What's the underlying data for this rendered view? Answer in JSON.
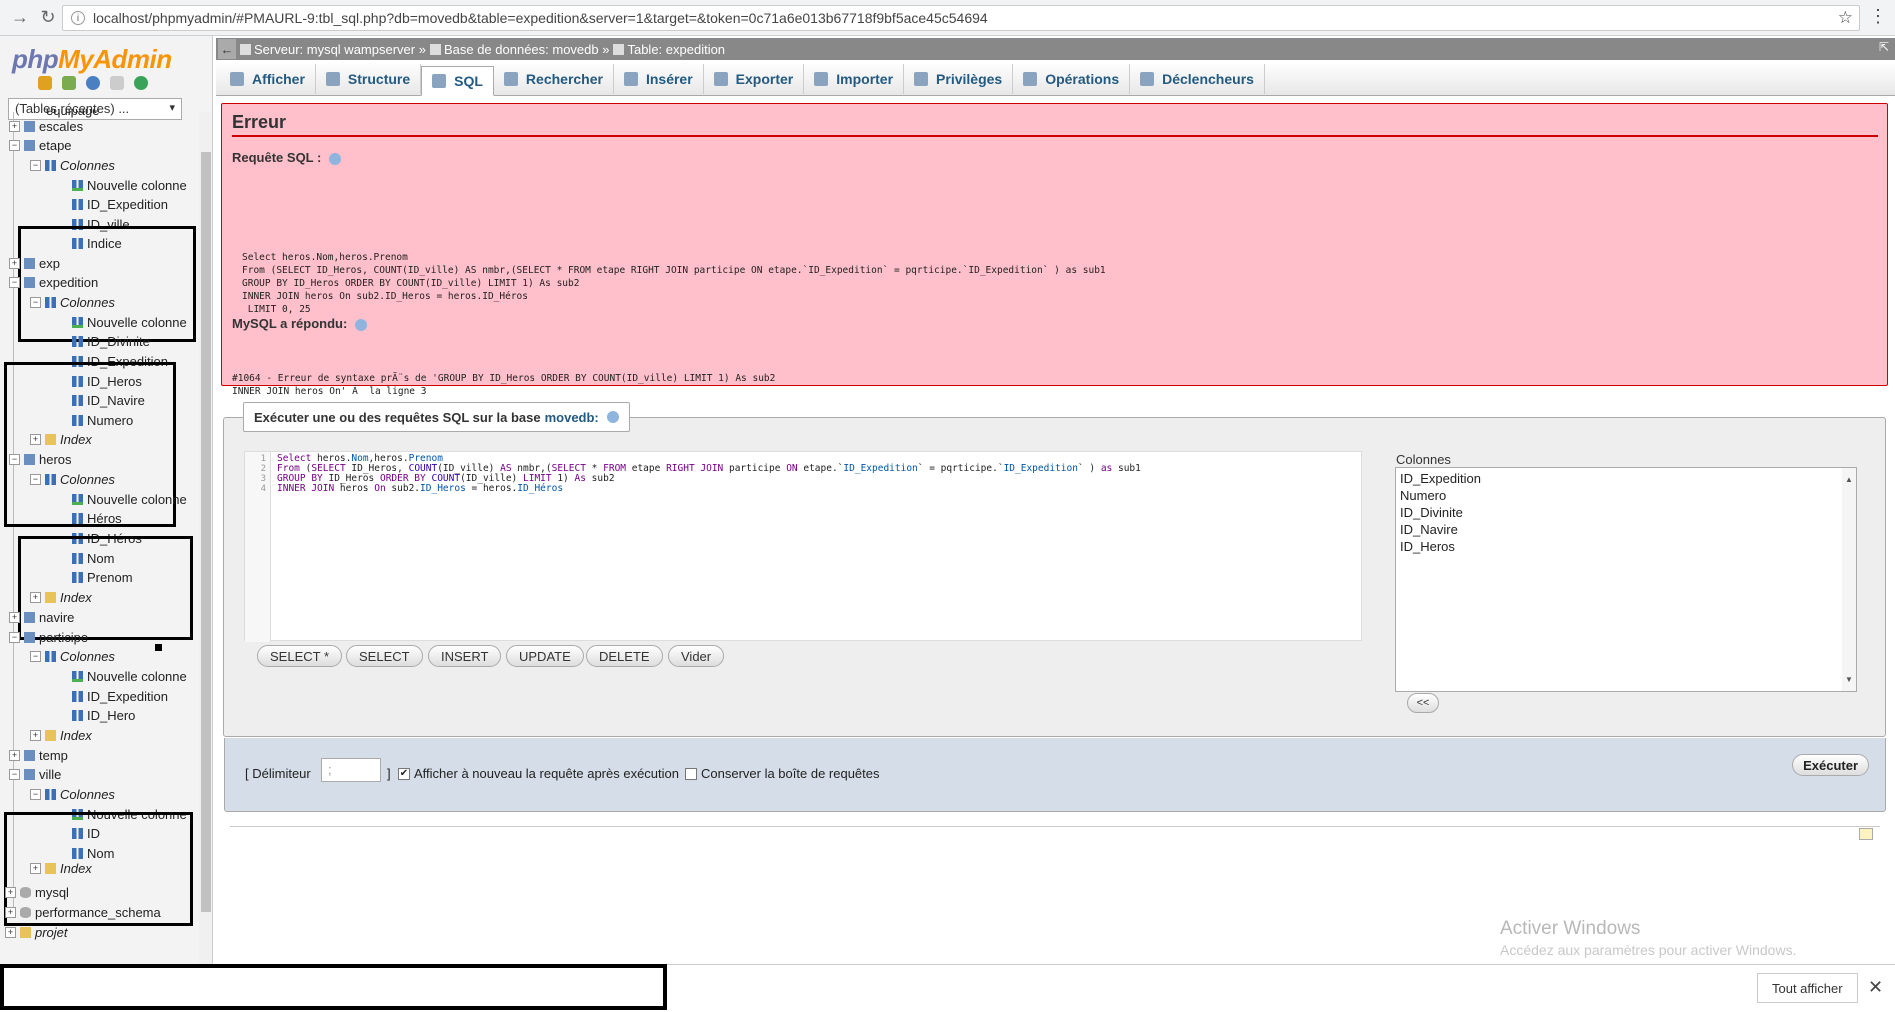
{
  "browser": {
    "url": "localhost/phpmyadmin/#PMAURL-9:tbl_sql.php?db=movedb&table=expedition&server=1&target=&token=0c71a6e013b67718f9bf5ace45c54694"
  },
  "sidebar": {
    "logo_php": "php",
    "logo_my": "MyAdmin",
    "recent_tables": "(Tables récentes) ...",
    "tree": {
      "equipage": "équipage",
      "escales": "escales",
      "etape": "etape",
      "colonnes": "Colonnes",
      "nouvelle_colonne": "Nouvelle colonne",
      "index": "Index",
      "indice": "Indice",
      "etape_cols": [
        "ID_Expedition",
        "ID_ville"
      ],
      "exp": "exp",
      "expedition": "expedition",
      "expedition_cols": [
        "ID_Divinite",
        "ID_Expedition",
        "ID_Heros",
        "ID_Navire",
        "Numero"
      ],
      "heros": "heros",
      "heros_cols": [
        "Héros",
        "ID_Héros",
        "Nom",
        "Prenom"
      ],
      "navire": "navire",
      "participe": "participe",
      "participe_cols": [
        "ID_Expedition",
        "ID_Hero"
      ],
      "temp": "temp",
      "ville": "ville",
      "ville_cols": [
        "ID",
        "Nom"
      ],
      "mysql": "mysql",
      "performance_schema": "performance_schema",
      "projet": "projet"
    }
  },
  "breadcrumb": {
    "server": "Serveur: mysql wampserver »",
    "database": "Base de données: movedb »",
    "table": "Table: expedition"
  },
  "tabs": [
    "Afficher",
    "Structure",
    "SQL",
    "Rechercher",
    "Insérer",
    "Exporter",
    "Importer",
    "Privilèges",
    "Opérations",
    "Déclencheurs"
  ],
  "error": {
    "title": "Erreur",
    "query_label": "Requête SQL :",
    "query_lines": [
      "Select heros.Nom,heros.Prenom",
      "From (SELECT ID_Heros, COUNT(ID_ville) AS nmbr,(SELECT * FROM etape RIGHT JOIN participe ON etape.`ID_Expedition` = pqrticipe.`ID_Expedition` ) as sub1",
      "GROUP BY ID_Heros ORDER BY COUNT(ID_ville) LIMIT 1) As sub2",
      "INNER JOIN heros On sub2.ID_Heros = heros.ID_Héros",
      " LIMIT 0, 25"
    ],
    "response_label": "MySQL a répondu:",
    "response_lines": [
      "#1064 - Erreur de syntaxe prÃ¨s de 'GROUP BY ID_Heros ORDER BY COUNT(ID_ville) LIMIT 1) As sub2",
      "INNER JOIN heros On' Ã  la ligne 3"
    ]
  },
  "sql_box": {
    "legend": "Exécuter une ou des requêtes SQL sur la base",
    "db": "movedb:",
    "line_numbers": [
      "1",
      "2",
      "3",
      "4"
    ],
    "columns_label": "Colonnes",
    "columns": [
      "ID_Expedition",
      "Numero",
      "ID_Divinite",
      "ID_Navire",
      "ID_Heros"
    ],
    "buttons": [
      "SELECT *",
      "SELECT",
      "INSERT",
      "UPDATE",
      "DELETE",
      "Vider"
    ],
    "insert_button": "<<",
    "delimiter_label": "[ Délimiteur",
    "delimiter_value": ";",
    "delimiter_close": "]",
    "show_again_label": "Afficher à nouveau la requête après exécution",
    "keep_box_label": "Conserver la boîte de requêtes",
    "execute": "Exécuter"
  },
  "watermark": {
    "title": "Activer Windows",
    "subtitle": "Accédez aux paramètres pour activer Windows."
  },
  "download_bar": {
    "show_all": "Tout afficher"
  }
}
